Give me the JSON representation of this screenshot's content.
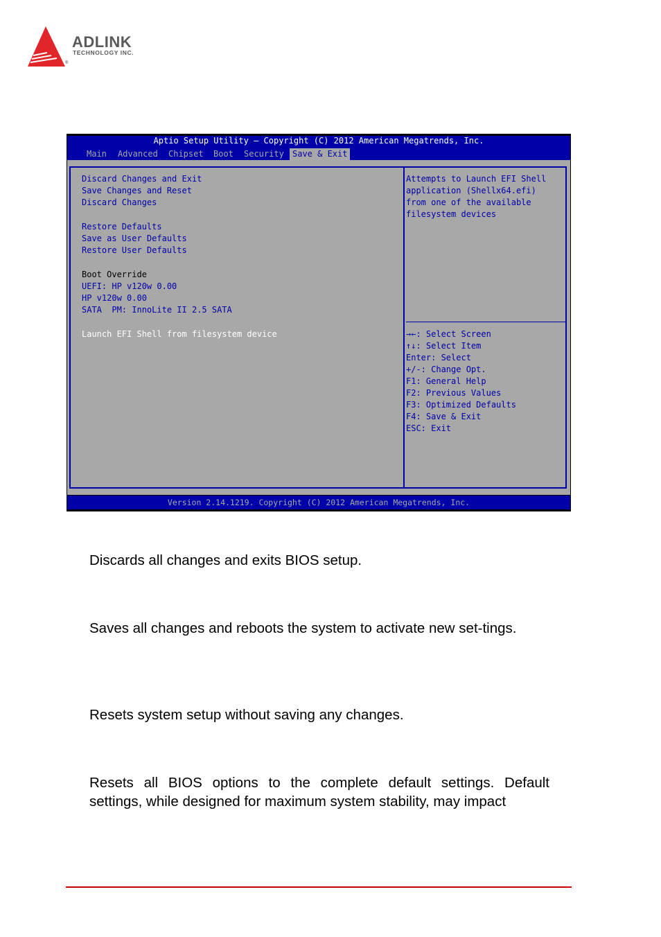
{
  "logo": {
    "brand": "ADLINK",
    "subtitle": "TECHNOLOGY INC.",
    "registered": "®",
    "colors": {
      "triangle": "#e0262b",
      "text": "#5a5a5a"
    }
  },
  "bios": {
    "title": "Aptio Setup Utility – Copyright (C) 2012 American Megatrends, Inc.",
    "tabs": [
      {
        "label": "Main",
        "active": false
      },
      {
        "label": "Advanced",
        "active": false
      },
      {
        "label": "Chipset",
        "active": false
      },
      {
        "label": "Boot",
        "active": false
      },
      {
        "label": "Security",
        "active": false
      },
      {
        "label": "Save & Exit",
        "active": true
      }
    ],
    "menu": [
      {
        "label": "Discard Changes and Exit",
        "type": "option"
      },
      {
        "label": "Save Changes and Reset",
        "type": "option"
      },
      {
        "label": "Discard Changes",
        "type": "option"
      },
      {
        "label": "Restore Defaults",
        "type": "option"
      },
      {
        "label": "Save as User Defaults",
        "type": "option"
      },
      {
        "label": "Restore User Defaults",
        "type": "option"
      },
      {
        "label": "Boot Override",
        "type": "label"
      },
      {
        "label": "UEFI: HP v120w 0.00",
        "type": "option"
      },
      {
        "label": "HP v120w 0.00",
        "type": "option"
      },
      {
        "label": "SATA  PM: InnoLite II 2.5 SATA",
        "type": "option"
      },
      {
        "label": "Launch EFI Shell from filesystem device",
        "type": "option",
        "selected": true
      }
    ],
    "help_text": [
      "Attempts to Launch EFI Shell",
      "application (Shellx64.efi)",
      "from one of the available",
      "filesystem devices"
    ],
    "key_help": [
      "→←: Select Screen",
      "↑↓: Select Item",
      "Enter: Select",
      "+/-: Change Opt.",
      "F1: General Help",
      "F2: Previous Values",
      "F3: Optimized Defaults",
      "F4: Save & Exit",
      "ESC: Exit"
    ],
    "footer": "Version 2.14.1219. Copyright (C) 2012 American Megatrends, Inc.",
    "colors": {
      "blue": "#0000a8",
      "gray": "#a8a8a8",
      "white": "#ffffff"
    }
  },
  "document": {
    "paragraphs": [
      "Discards all changes and exits BIOS setup.",
      "Saves all changes and reboots the system to activate new set-tings.",
      "Resets system setup without saving any changes.",
      "Resets all BIOS options to the complete default settings. Default settings, while designed for maximum system stability, may impact"
    ],
    "rule_color": "#cc0000"
  }
}
